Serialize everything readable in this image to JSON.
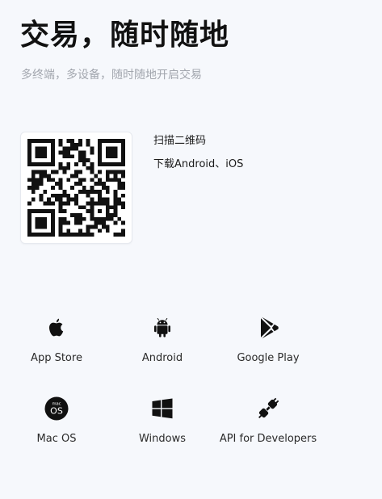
{
  "header": {
    "title": "交易，随时随地",
    "subtitle": "多终端，多设备，随时随地开启交易"
  },
  "qr": {
    "line1": "扫描二维码",
    "line2": "下载Android、iOS"
  },
  "platforms": [
    {
      "label": "App Store",
      "icon": "apple-icon"
    },
    {
      "label": "Android",
      "icon": "android-icon"
    },
    {
      "label": "Google Play",
      "icon": "google-play-icon"
    },
    {
      "label": "Mac OS",
      "icon": "mac-os-icon"
    },
    {
      "label": "Windows",
      "icon": "windows-icon"
    },
    {
      "label": "API for Developers",
      "icon": "plug-icon"
    }
  ],
  "mac_badge": {
    "small": "mac",
    "big": "OS"
  }
}
